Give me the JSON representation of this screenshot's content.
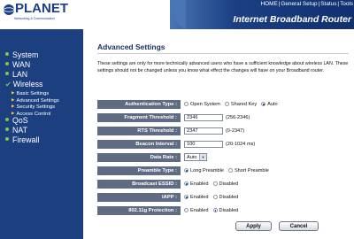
{
  "brand": {
    "name": "PLANET",
    "tagline": "Networking & Communication",
    "accent": "#1a3f86"
  },
  "header": {
    "links": [
      "HOME",
      "General Setup",
      "Status",
      "Tools"
    ],
    "separator": "|",
    "product_title": "Internet Broadband Router"
  },
  "sidebar": {
    "items": [
      {
        "label": "System",
        "marker": "bullet"
      },
      {
        "label": "WAN",
        "marker": "bullet"
      },
      {
        "label": "LAN",
        "marker": "bullet"
      },
      {
        "label": "Wireless",
        "marker": "check"
      },
      {
        "label": "QoS",
        "marker": "bullet"
      },
      {
        "label": "NAT",
        "marker": "bullet"
      },
      {
        "label": "Firewall",
        "marker": "bullet"
      }
    ],
    "wireless_subitems": [
      "Basic Settings",
      "Advanced Settings",
      "Security Settings",
      "Access Control"
    ]
  },
  "main": {
    "title": "Advanced Settings",
    "description": "These settings are only for more technically advanced users who have a sufficient knowledge about wireless LAN. These settings should not be changed unless you know what effect the changes will have on your Broadband router.",
    "fields": {
      "auth_type": {
        "label": "Authentication Type :",
        "options": [
          "Open System",
          "Shared Key",
          "Auto"
        ],
        "selected": "Auto"
      },
      "fragment": {
        "label": "Fragment Threshold :",
        "value": "2346",
        "hint": "(256-2346)"
      },
      "rts": {
        "label": "RTS Threshold :",
        "value": "2347",
        "hint": "(0-2347)"
      },
      "beacon": {
        "label": "Beacon Interval :",
        "value": "100",
        "hint": "(20-1024 ms)"
      },
      "data_rate": {
        "label": "Data Rate :",
        "value": "Auto"
      },
      "preamble": {
        "label": "Preamble Type :",
        "options": [
          "Long Preamble",
          "Short Preamble"
        ],
        "selected": "Long Preamble"
      },
      "essid": {
        "label": "Broadcast ESSID :",
        "options": [
          "Enabled",
          "Disabled"
        ],
        "selected": "Enabled"
      },
      "iapp": {
        "label": "IAPP :",
        "options": [
          "Enabled",
          "Disabled"
        ],
        "selected": "Enabled"
      },
      "protection": {
        "label": "802.11g Protection :",
        "options": [
          "Enabled",
          "Disabled"
        ],
        "selected": "Disabled"
      }
    },
    "buttons": {
      "apply": "Apply",
      "cancel": "Cancel"
    }
  }
}
